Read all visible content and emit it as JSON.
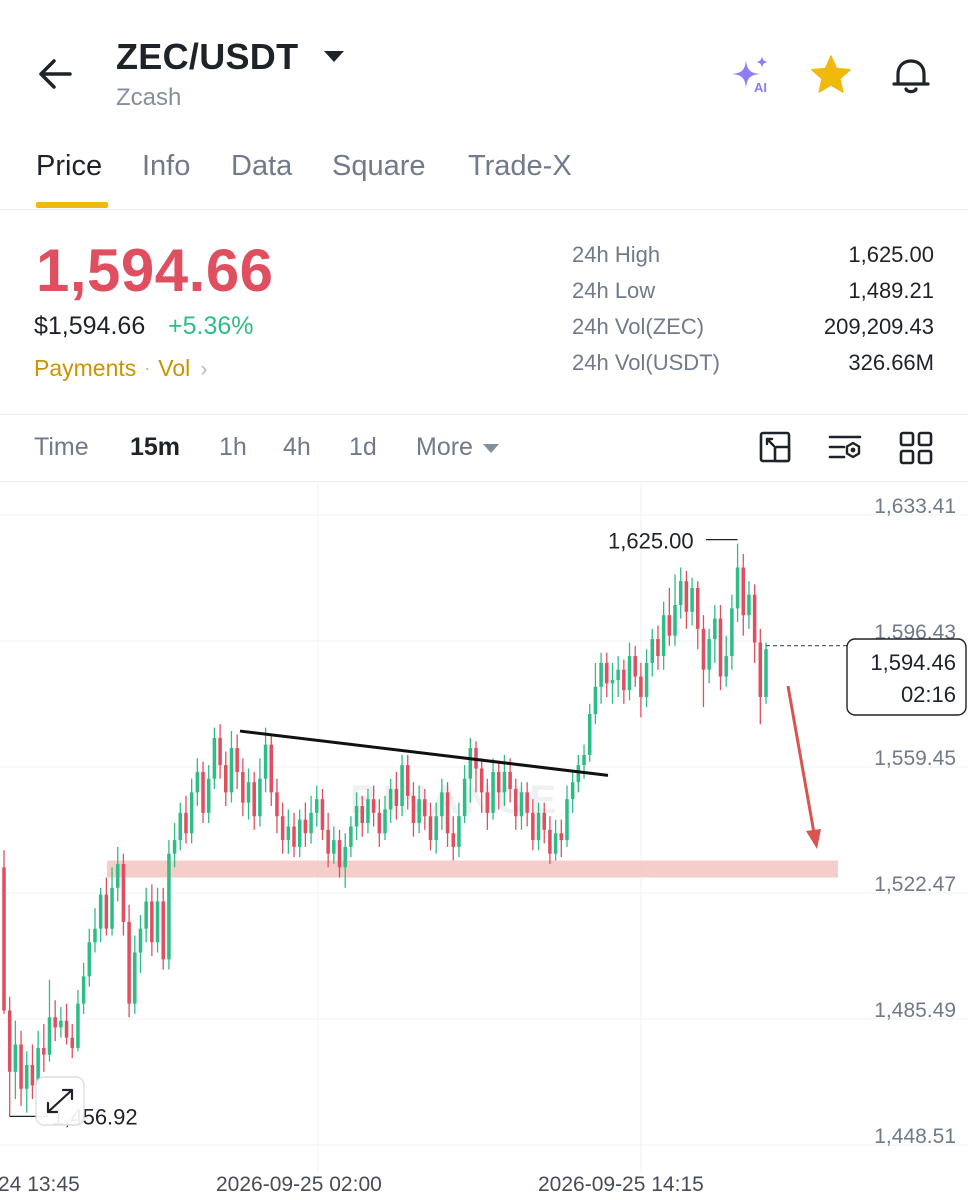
{
  "header": {
    "pair": "ZEC/USDT",
    "subtitle": "Zcash",
    "icons": [
      "back-arrow-icon",
      "caret-down-icon",
      "ai-sparkle-icon",
      "star-icon",
      "bell-icon"
    ],
    "ai_badge": "AI"
  },
  "tabs": [
    {
      "label": "Price",
      "active": true
    },
    {
      "label": "Info",
      "active": false
    },
    {
      "label": "Data",
      "active": false
    },
    {
      "label": "Square",
      "active": false
    },
    {
      "label": "Trade-X",
      "active": false
    }
  ],
  "price": {
    "last": "1,594.66",
    "usd": "$1,594.66",
    "change": "+5.36%",
    "tag_payments": "Payments",
    "tag_vol": "Vol"
  },
  "stats": [
    {
      "label": "24h High",
      "value": "1,625.00"
    },
    {
      "label": "24h Low",
      "value": "1,489.21"
    },
    {
      "label": "24h Vol(ZEC)",
      "value": "209,209.43"
    },
    {
      "label": "24h Vol(USDT)",
      "value": "326.66M"
    }
  ],
  "intervals": [
    {
      "label": "Time",
      "active": false
    },
    {
      "label": "15m",
      "active": true
    },
    {
      "label": "1h",
      "active": false
    },
    {
      "label": "4h",
      "active": false
    },
    {
      "label": "1d",
      "active": false
    },
    {
      "label": "More",
      "active": false
    }
  ],
  "colors": {
    "up": "#2ebd85",
    "down": "#e04f5f",
    "accent": "#f0b90b",
    "support_zone": "#f3c5c1",
    "arrow": "#d9534f"
  },
  "chart_data": {
    "type": "candlestick",
    "y_ticks": [
      "1,633.41",
      "1,596.43",
      "1,559.45",
      "1,522.47",
      "1,485.49",
      "1,448.51"
    ],
    "y_tick_values": [
      1633.41,
      1596.43,
      1559.45,
      1522.47,
      1485.49,
      1448.51
    ],
    "x_ticks": [
      "24 13:45",
      "2026-09-25 02:00",
      "2026-09-25 14:15"
    ],
    "ylim": [
      1448.51,
      1633.41
    ],
    "high_label": "1,625.00",
    "low_label": "1,456.92",
    "current_price": "1,594.46",
    "countdown": "02:16",
    "watermark": "BINANCE",
    "support_zone": [
      1527,
      1532
    ],
    "trendline": {
      "from": 1570,
      "to": 1557
    },
    "candles": [
      [
        1530,
        1488,
        1535,
        1487
      ],
      [
        1488,
        1470,
        1492,
        1456.92
      ],
      [
        1470,
        1478,
        1485,
        1462
      ],
      [
        1478,
        1465,
        1482,
        1460
      ],
      [
        1465,
        1472,
        1476,
        1458
      ],
      [
        1472,
        1466,
        1478,
        1462
      ],
      [
        1466,
        1477,
        1482,
        1463
      ],
      [
        1477,
        1475,
        1484,
        1470
      ],
      [
        1475,
        1486,
        1497,
        1473
      ],
      [
        1486,
        1483,
        1491,
        1479
      ],
      [
        1483,
        1485,
        1489,
        1480
      ],
      [
        1485,
        1480,
        1490,
        1478
      ],
      [
        1480,
        1477,
        1484,
        1474
      ],
      [
        1477,
        1490,
        1494,
        1476
      ],
      [
        1490,
        1498,
        1502,
        1487
      ],
      [
        1498,
        1508,
        1512,
        1495
      ],
      [
        1508,
        1512,
        1518,
        1505
      ],
      [
        1512,
        1522,
        1524,
        1508
      ],
      [
        1522,
        1512,
        1527,
        1510
      ],
      [
        1512,
        1524,
        1530,
        1510
      ],
      [
        1524,
        1531,
        1536,
        1520
      ],
      [
        1531,
        1514,
        1534,
        1510
      ],
      [
        1514,
        1490,
        1519,
        1486
      ],
      [
        1490,
        1505,
        1510,
        1487
      ],
      [
        1505,
        1512,
        1516,
        1499
      ],
      [
        1512,
        1520,
        1524,
        1508
      ],
      [
        1520,
        1508,
        1525,
        1504
      ],
      [
        1508,
        1520,
        1524,
        1505
      ],
      [
        1520,
        1503,
        1524,
        1500
      ],
      [
        1503,
        1534,
        1538,
        1500
      ],
      [
        1534,
        1538,
        1543,
        1530
      ],
      [
        1538,
        1546,
        1549,
        1535
      ],
      [
        1546,
        1540,
        1551,
        1537
      ],
      [
        1540,
        1552,
        1556,
        1537
      ],
      [
        1552,
        1558,
        1562,
        1548
      ],
      [
        1558,
        1546,
        1561,
        1543
      ],
      [
        1546,
        1556,
        1560,
        1543
      ],
      [
        1556,
        1568,
        1571,
        1553
      ],
      [
        1568,
        1560,
        1572,
        1556
      ],
      [
        1560,
        1552,
        1564,
        1548
      ],
      [
        1552,
        1565,
        1570,
        1549
      ],
      [
        1565,
        1558,
        1569,
        1553
      ],
      [
        1558,
        1549,
        1562,
        1545
      ],
      [
        1549,
        1555,
        1559,
        1544
      ],
      [
        1555,
        1545,
        1558,
        1541
      ],
      [
        1545,
        1556,
        1562,
        1542
      ],
      [
        1556,
        1566,
        1571,
        1552
      ],
      [
        1566,
        1552,
        1569,
        1548
      ],
      [
        1552,
        1545,
        1556,
        1540
      ],
      [
        1545,
        1538,
        1549,
        1534
      ],
      [
        1538,
        1542,
        1547,
        1534
      ],
      [
        1542,
        1536,
        1546,
        1533
      ],
      [
        1536,
        1544,
        1547,
        1533
      ],
      [
        1544,
        1540,
        1549,
        1536
      ],
      [
        1540,
        1546,
        1551,
        1537
      ],
      [
        1546,
        1550,
        1554,
        1542
      ],
      [
        1550,
        1541,
        1553,
        1538
      ],
      [
        1541,
        1534,
        1546,
        1530
      ],
      [
        1534,
        1538,
        1542,
        1531
      ],
      [
        1538,
        1530,
        1541,
        1527
      ],
      [
        1530,
        1536,
        1540,
        1524
      ],
      [
        1536,
        1542,
        1545,
        1533
      ],
      [
        1542,
        1548,
        1552,
        1538
      ],
      [
        1548,
        1543,
        1551,
        1539
      ],
      [
        1543,
        1550,
        1553,
        1540
      ],
      [
        1550,
        1546,
        1554,
        1542
      ],
      [
        1546,
        1540,
        1550,
        1536
      ],
      [
        1540,
        1547,
        1551,
        1538
      ],
      [
        1547,
        1553,
        1556,
        1543
      ],
      [
        1553,
        1548,
        1558,
        1544
      ],
      [
        1548,
        1560,
        1563,
        1545
      ],
      [
        1560,
        1551,
        1563,
        1547
      ],
      [
        1551,
        1543,
        1555,
        1539
      ],
      [
        1543,
        1550,
        1554,
        1540
      ],
      [
        1550,
        1545,
        1553,
        1541
      ],
      [
        1545,
        1538,
        1549,
        1535
      ],
      [
        1538,
        1545,
        1549,
        1534
      ],
      [
        1545,
        1552,
        1556,
        1541
      ],
      [
        1552,
        1540,
        1555,
        1536
      ],
      [
        1540,
        1536,
        1545,
        1532
      ],
      [
        1536,
        1545,
        1549,
        1533
      ],
      [
        1545,
        1556,
        1560,
        1543
      ],
      [
        1556,
        1565,
        1568,
        1549
      ],
      [
        1565,
        1559,
        1567,
        1552
      ],
      [
        1559,
        1552,
        1562,
        1546
      ],
      [
        1552,
        1546,
        1556,
        1541
      ],
      [
        1546,
        1558,
        1562,
        1544
      ],
      [
        1558,
        1552,
        1561,
        1547
      ],
      [
        1552,
        1558,
        1563,
        1548
      ],
      [
        1558,
        1553,
        1562,
        1549
      ],
      [
        1553,
        1545,
        1556,
        1541
      ],
      [
        1545,
        1552,
        1555,
        1541
      ],
      [
        1552,
        1546,
        1555,
        1542
      ],
      [
        1546,
        1538,
        1550,
        1535
      ],
      [
        1538,
        1546,
        1549,
        1535
      ],
      [
        1546,
        1541,
        1549,
        1537
      ],
      [
        1541,
        1534,
        1545,
        1531
      ],
      [
        1534,
        1540,
        1544,
        1532
      ],
      [
        1540,
        1538,
        1544,
        1533
      ],
      [
        1538,
        1550,
        1554,
        1536
      ],
      [
        1550,
        1555,
        1558,
        1546
      ],
      [
        1555,
        1560,
        1563,
        1552
      ],
      [
        1560,
        1563,
        1566,
        1556
      ],
      [
        1563,
        1575,
        1578,
        1561
      ],
      [
        1575,
        1583,
        1590,
        1572
      ],
      [
        1583,
        1590,
        1593,
        1578
      ],
      [
        1590,
        1584,
        1593,
        1580
      ],
      [
        1584,
        1585,
        1590,
        1578
      ],
      [
        1585,
        1588,
        1592,
        1580
      ],
      [
        1588,
        1582,
        1591,
        1578
      ],
      [
        1582,
        1592,
        1596,
        1579
      ],
      [
        1592,
        1586,
        1595,
        1583
      ],
      [
        1586,
        1580,
        1590,
        1574
      ],
      [
        1580,
        1590,
        1594,
        1577
      ],
      [
        1590,
        1597,
        1600,
        1586
      ],
      [
        1597,
        1592,
        1601,
        1588
      ],
      [
        1592,
        1604,
        1608,
        1588
      ],
      [
        1604,
        1598,
        1612,
        1595
      ],
      [
        1598,
        1607,
        1616,
        1595
      ],
      [
        1607,
        1614,
        1618,
        1603
      ],
      [
        1614,
        1605,
        1617,
        1600
      ],
      [
        1605,
        1612,
        1615,
        1601
      ],
      [
        1612,
        1600,
        1614,
        1594
      ],
      [
        1600,
        1588,
        1604,
        1577
      ],
      [
        1588,
        1597,
        1600,
        1584
      ],
      [
        1597,
        1603,
        1607,
        1590
      ],
      [
        1603,
        1586,
        1607,
        1582
      ],
      [
        1586,
        1592,
        1598,
        1583
      ],
      [
        1592,
        1606,
        1610,
        1588
      ],
      [
        1606,
        1618,
        1625,
        1602
      ],
      [
        1618,
        1604,
        1622,
        1598
      ],
      [
        1604,
        1610,
        1614,
        1600
      ],
      [
        1610,
        1596,
        1613,
        1590
      ],
      [
        1596,
        1580,
        1600,
        1572
      ],
      [
        1580,
        1594,
        1596,
        1578
      ]
    ]
  }
}
